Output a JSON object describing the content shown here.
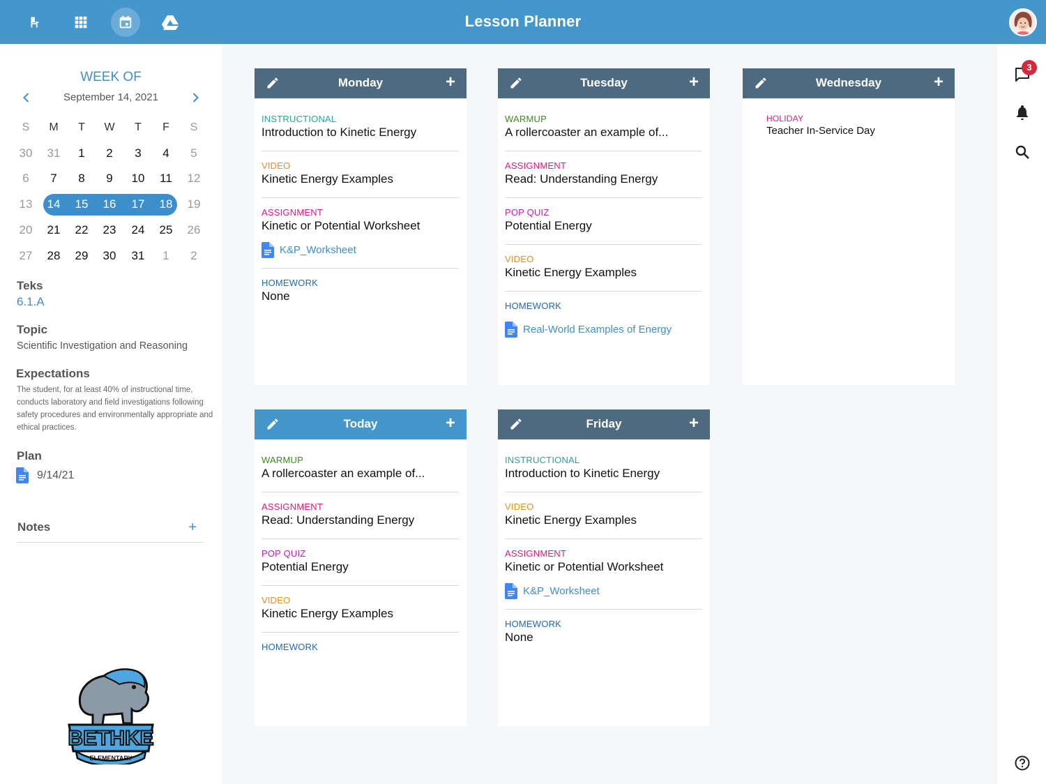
{
  "app": {
    "title": "Lesson Planner"
  },
  "nav": {
    "icons": [
      "desk-icon",
      "apps-grid-icon",
      "calendar-icon",
      "drive-icon"
    ],
    "active": "calendar-icon",
    "accent": "#4397cd"
  },
  "sidebar": {
    "week_of_label": "WEEK OF",
    "week_date": "September 14, 2021",
    "calendar": {
      "weekdays": [
        "S",
        "M",
        "T",
        "W",
        "T",
        "F",
        "S"
      ],
      "rows": [
        [
          "30",
          "31",
          "1",
          "2",
          "3",
          "4",
          "5"
        ],
        [
          "6",
          "7",
          "8",
          "9",
          "10",
          "11",
          "12"
        ],
        [
          "13",
          "14",
          "15",
          "16",
          "17",
          "18",
          "19"
        ],
        [
          "20",
          "21",
          "22",
          "23",
          "24",
          "25",
          "26"
        ],
        [
          "27",
          "28",
          "29",
          "30",
          "31",
          "1",
          "2"
        ]
      ],
      "selected_week": [
        "14",
        "15",
        "16",
        "17",
        "18"
      ]
    },
    "teks_label": "Teks",
    "teks_value": "6.1.A",
    "topic_label": "Topic",
    "topic_value": "Scientific Investigation and Reasoning",
    "expectations_label": "Expectations",
    "expectations_value": "The student, for at least 40% of instructional time, conducts laboratory and field investigations following safety procedures and environmentally appropriate and ethical practices.",
    "plan_label": "Plan",
    "plan_file": "9/14/21",
    "notes_label": "Notes",
    "notes_add": "+",
    "logo": {
      "name": "BETHKE",
      "sub": "ELEMENTARY"
    }
  },
  "days": {
    "monday": {
      "label": "Monday",
      "items": [
        {
          "category": "INSTRUCTIONAL",
          "title": "Introduction to Kinetic Energy"
        },
        {
          "category": "VIDEO",
          "title": "Kinetic Energy Examples"
        },
        {
          "category": "ASSIGNMENT",
          "title": "Kinetic or Potential Worksheet",
          "file": "K&P_Worksheet"
        },
        {
          "category": "HOMEWORK",
          "title": "None"
        }
      ]
    },
    "tuesday": {
      "label": "Tuesday",
      "items": [
        {
          "category": "WARMUP",
          "title": "A rollercoaster an example of..."
        },
        {
          "category": "ASSIGNMENT",
          "title": "Read: Understanding Energy"
        },
        {
          "category": "POP QUIZ",
          "title": "Potential Energy"
        },
        {
          "category": "VIDEO",
          "title": "Kinetic Energy Examples"
        },
        {
          "category": "HOMEWORK",
          "file": "Real-World Examples of Energy"
        }
      ]
    },
    "wednesday": {
      "label": "Wednesday",
      "items": [
        {
          "category": "HOLIDAY",
          "title": "Teacher In-Service Day"
        }
      ]
    },
    "today": {
      "label": "Today",
      "items": [
        {
          "category": "WARMUP",
          "title": "A rollercoaster an example of..."
        },
        {
          "category": "ASSIGNMENT",
          "title": "Read: Understanding Energy"
        },
        {
          "category": "POP QUIZ",
          "title": "Potential Energy"
        },
        {
          "category": "VIDEO",
          "title": "Kinetic Energy Examples"
        },
        {
          "category": "HOMEWORK"
        }
      ]
    },
    "friday": {
      "label": "Friday",
      "items": [
        {
          "category": "INSTRUCTIONAL",
          "title": "Introduction to Kinetic Energy"
        },
        {
          "category": "VIDEO",
          "title": "Kinetic Energy Examples"
        },
        {
          "category": "ASSIGNMENT",
          "title": "Kinetic or Potential Worksheet",
          "file": "K&P_Worksheet"
        },
        {
          "category": "HOMEWORK",
          "title": "None"
        }
      ]
    }
  },
  "card_controls": {
    "add": "+"
  },
  "rail": {
    "messages_badge": "3",
    "icons": [
      "chat-icon",
      "bell-icon",
      "search-icon",
      "help-icon"
    ]
  },
  "colors": {
    "instructional": "#2aa39a",
    "video": "#f08c21",
    "assignment": "#e0197c",
    "homework": "#2467b4",
    "warmup": "#3b8a1e",
    "pop_quiz": "#c216c9",
    "holiday": "#e0197c",
    "header": "#4e6a80",
    "today_header": "#4397cd"
  }
}
